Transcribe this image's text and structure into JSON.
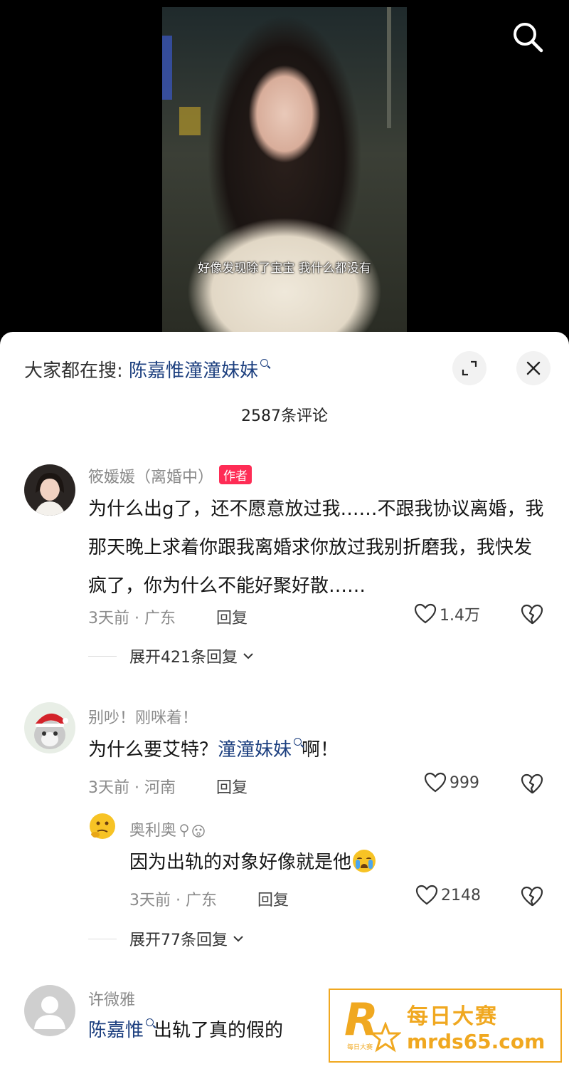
{
  "video": {
    "subtitle": "好像发现除了宝宝 我什么都没有"
  },
  "search_suggest": {
    "prefix": "大家都在搜: ",
    "term": "陈嘉惟潼潼妹妹"
  },
  "comment_count": "2587条评论",
  "comments": [
    {
      "username": "筱媛媛（离婚中）",
      "badge": "作者",
      "text": "为什么出g了，还不愿意放过我……不跟我协议离婚，我那天晚上求着你跟我离婚求你放过我别折磨我，我快发疯了，你为什么不能好聚好散……",
      "meta": "3天前 · 广东",
      "reply": "回复",
      "likes": "1.4万",
      "expand": "展开421条回复"
    },
    {
      "username": "别吵！刚咪着！",
      "text_before": "为什么要艾特？",
      "text_term": "潼潼妹妹",
      "text_after": "啊！",
      "meta": "3天前 · 河南",
      "reply": "回复",
      "likes": "999",
      "sub_reply": {
        "username": "奥利奥",
        "text": "因为出轨的对象好像就是他",
        "meta": "3天前 · 广东",
        "reply": "回复",
        "likes": "2148"
      },
      "expand": "展开77条回复"
    },
    {
      "username": "许微雅",
      "text_term": "陈嘉惟",
      "text_after": "出轨了真的假的"
    }
  ],
  "watermark": {
    "logo_letter": "R",
    "logo_small": "每日大赛",
    "title": "每日大赛",
    "url": "mrds65.com"
  },
  "colors": {
    "accent": "#fe2c55",
    "link": "#1c3f7f",
    "watermark": "#f0a820"
  },
  "icons": [
    "search-icon",
    "expand-icon",
    "close-icon",
    "heart-icon",
    "broken-heart-icon",
    "chevron-down-icon",
    "crying-face-emoji"
  ]
}
